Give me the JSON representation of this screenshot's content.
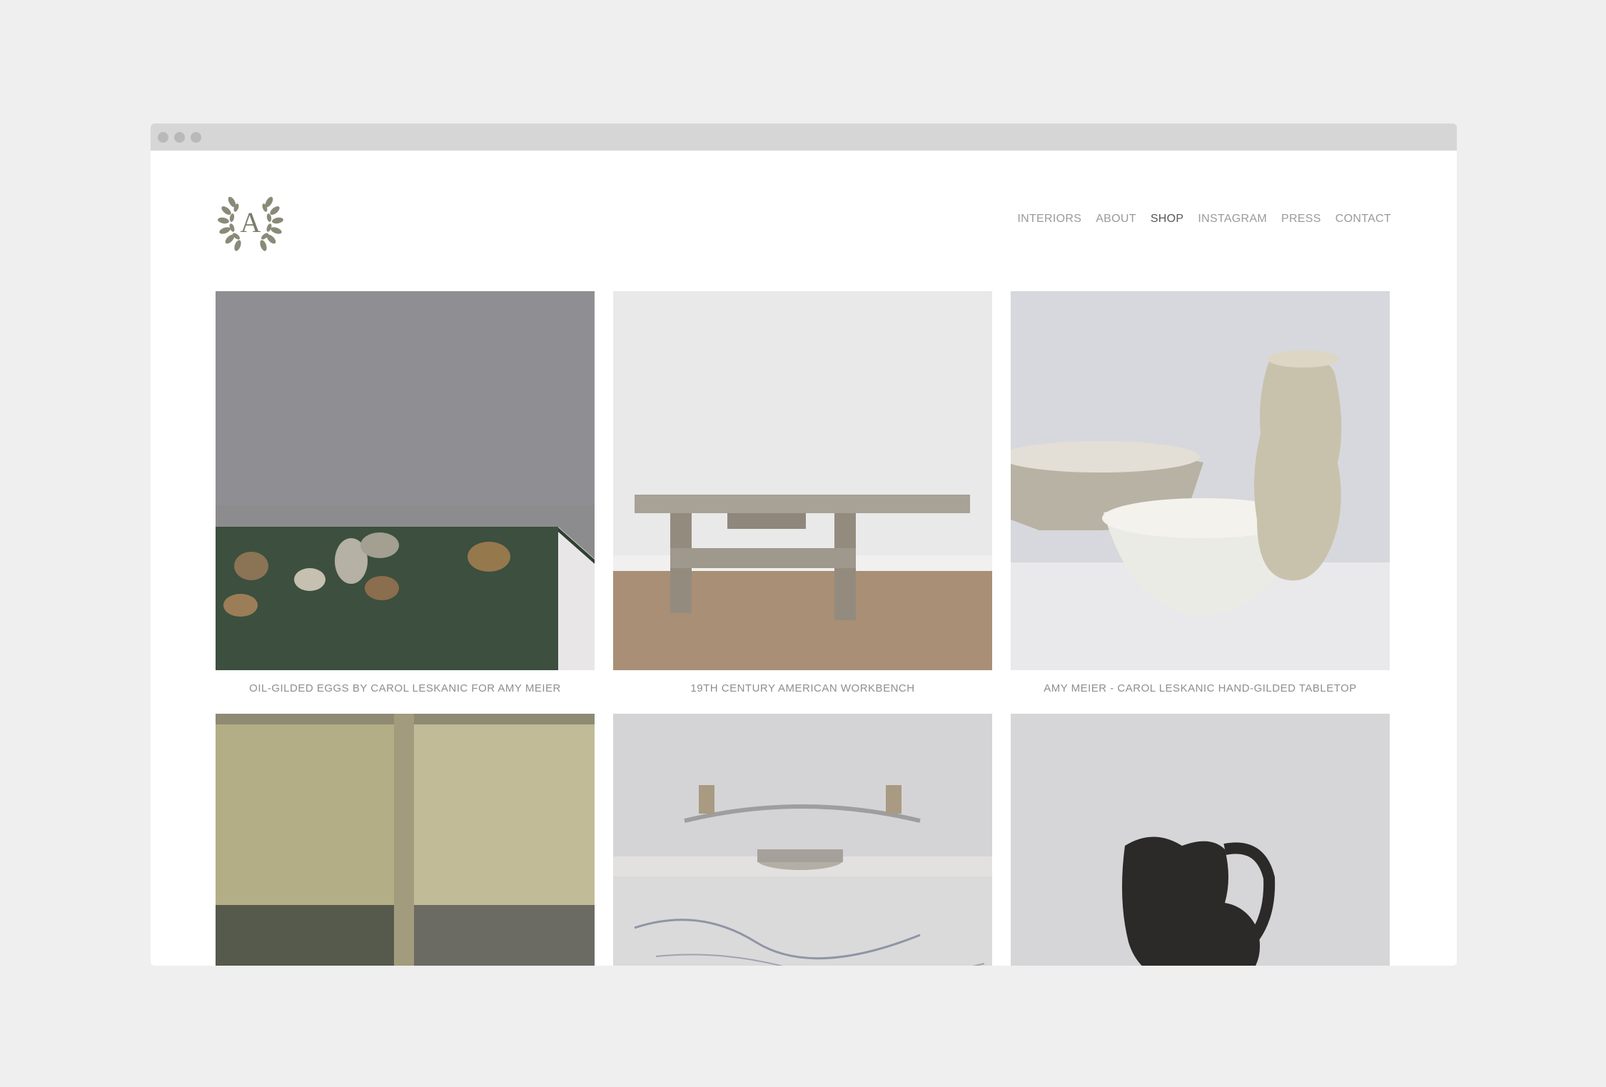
{
  "brand": {
    "logo_letter": "A"
  },
  "nav": {
    "items": [
      {
        "label": "INTERIORS"
      },
      {
        "label": "ABOUT"
      },
      {
        "label": "SHOP"
      },
      {
        "label": "INSTAGRAM"
      },
      {
        "label": "PRESS"
      },
      {
        "label": "CONTACT"
      }
    ],
    "active": "SHOP"
  },
  "products": [
    {
      "caption": "OIL-GILDED EGGS BY CAROL LESKANIC FOR AMY MEIER"
    },
    {
      "caption": "19TH CENTURY AMERICAN WORKBENCH"
    },
    {
      "caption": "AMY MEIER - CAROL LESKANIC HAND-GILDED TABLETOP"
    },
    {
      "caption": ""
    },
    {
      "caption": ""
    },
    {
      "caption": ""
    }
  ],
  "colors": {
    "page_bg": "#efefef",
    "chrome": "#d6d6d6",
    "logo": "#8a8a78",
    "nav_text": "#9a9a9a",
    "nav_active": "#555555"
  }
}
